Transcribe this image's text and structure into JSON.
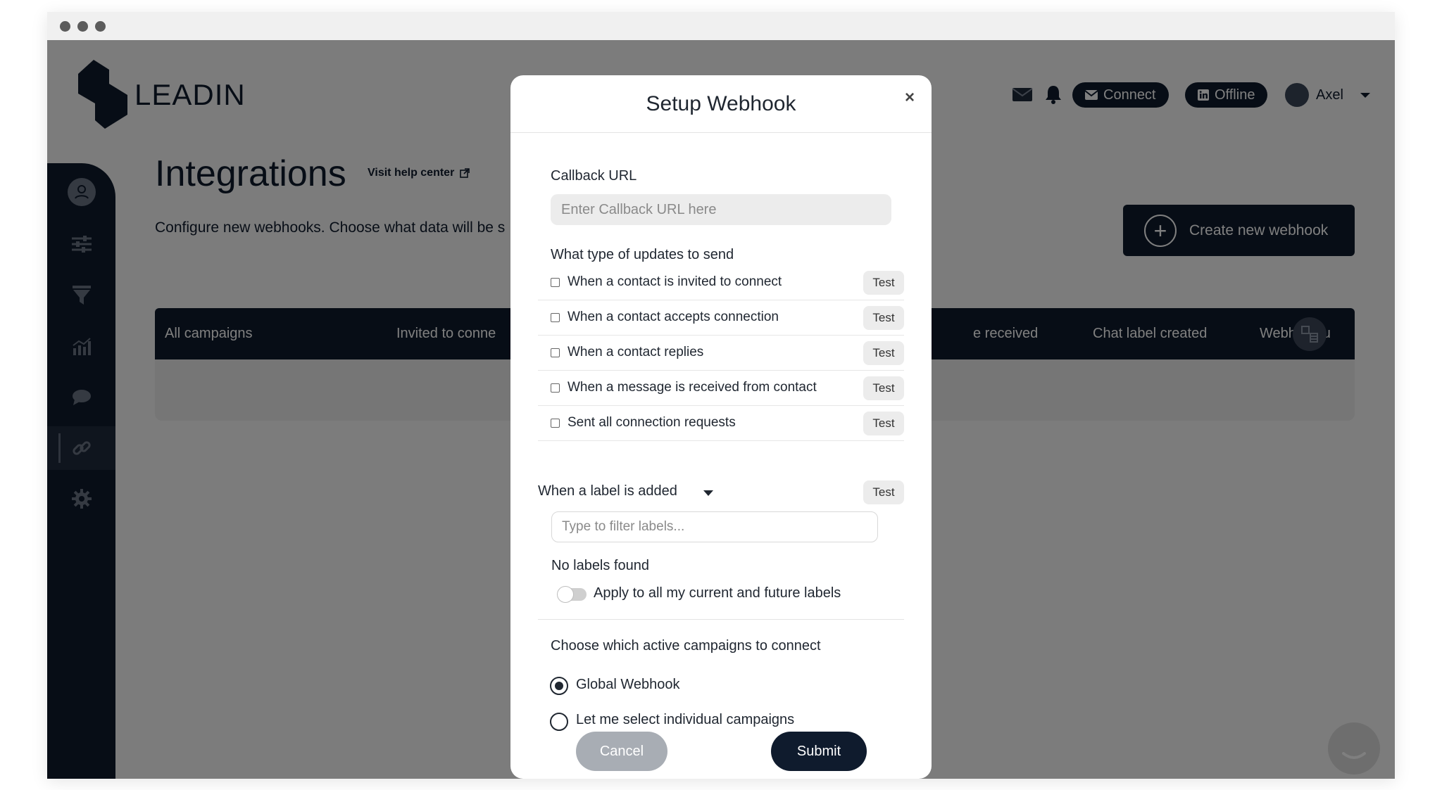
{
  "app": {
    "brand": "LEADIN"
  },
  "header": {
    "connect_label": "Connect",
    "offline_label": "Offline",
    "user_name": "Axel"
  },
  "page": {
    "title": "Integrations",
    "help_link": "Visit help center",
    "description": "Configure new webhooks. Choose what data will be s",
    "create_button": "Create new webhook"
  },
  "table": {
    "columns": [
      "All campaigns",
      "Invited to conne",
      "e received",
      "Chat label created",
      "Webhook u"
    ]
  },
  "modal": {
    "title": "Setup Webhook",
    "close_label": "×",
    "callback_label": "Callback URL",
    "callback_placeholder": "Enter Callback URL here",
    "updates_label": "What type of updates to send",
    "events": [
      {
        "label": "When a contact is invited to connect",
        "test": "Test"
      },
      {
        "label": "When a contact accepts connection",
        "test": "Test"
      },
      {
        "label": "When a contact replies",
        "test": "Test"
      },
      {
        "label": "When a message is received from contact",
        "test": "Test"
      },
      {
        "label": "Sent all connection requests",
        "test": "Test"
      }
    ],
    "label_event": {
      "label": "When a label is added",
      "test": "Test"
    },
    "filter_placeholder": "Type to filter labels...",
    "no_labels": "No labels found",
    "apply_all_label": "Apply to all my current and future labels",
    "campaigns_label": "Choose which active campaigns to connect",
    "radio_global": "Global Webhook",
    "radio_individual": "Let me select individual campaigns",
    "cancel_label": "Cancel",
    "submit_label": "Submit"
  },
  "colors": {
    "navy": "#0f1b2d",
    "overlay": "rgba(0,0,0,0.5)",
    "cancel": "#a8adb4"
  }
}
